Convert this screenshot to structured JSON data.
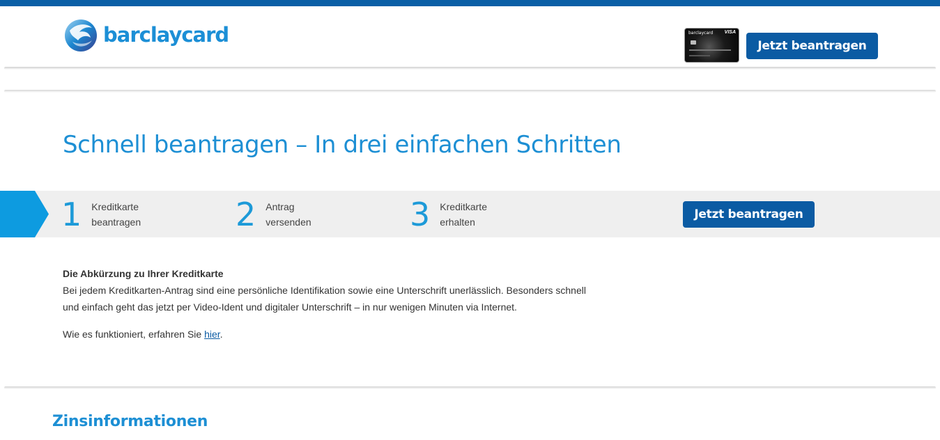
{
  "header": {
    "logo_text": "barclaycard",
    "logo_icon": "barclaycard-eagle-logo",
    "card_image": {
      "issuer": "barclaycard",
      "network": "VISA"
    },
    "cta_label": "Jetzt beantragen"
  },
  "hero": {
    "title": "Schnell beantragen – In drei einfachen Schritten"
  },
  "steps": {
    "items": [
      {
        "number": "1",
        "line1": "Kreditkarte",
        "line2": "beantragen"
      },
      {
        "number": "2",
        "line1": "Antrag",
        "line2": "versenden"
      },
      {
        "number": "3",
        "line1": "Kreditkarte",
        "line2": "erhalten"
      }
    ],
    "cta_label": "Jetzt beantragen"
  },
  "intro": {
    "heading": "Die Abkürzung zu Ihrer Kreditkarte",
    "body": "Bei jedem Kreditkarten-Antrag sind eine persönliche Identifikation sowie eine Unterschrift unerlässlich. Besonders schnell und einfach geht das jetzt per Video-Ident und digitaler Unterschrift – in nur wenigen Minuten via Internet.",
    "link_prefix": "Wie es funktioniert, erfahren Sie ",
    "link_text": "hier",
    "link_suffix": "."
  },
  "section": {
    "title": "Zinsinformationen"
  },
  "colors": {
    "brand_dark": "#0b5ba3",
    "brand_light": "#1d8fd4",
    "stripe": "#0a5fa6",
    "band": "#efefef"
  }
}
